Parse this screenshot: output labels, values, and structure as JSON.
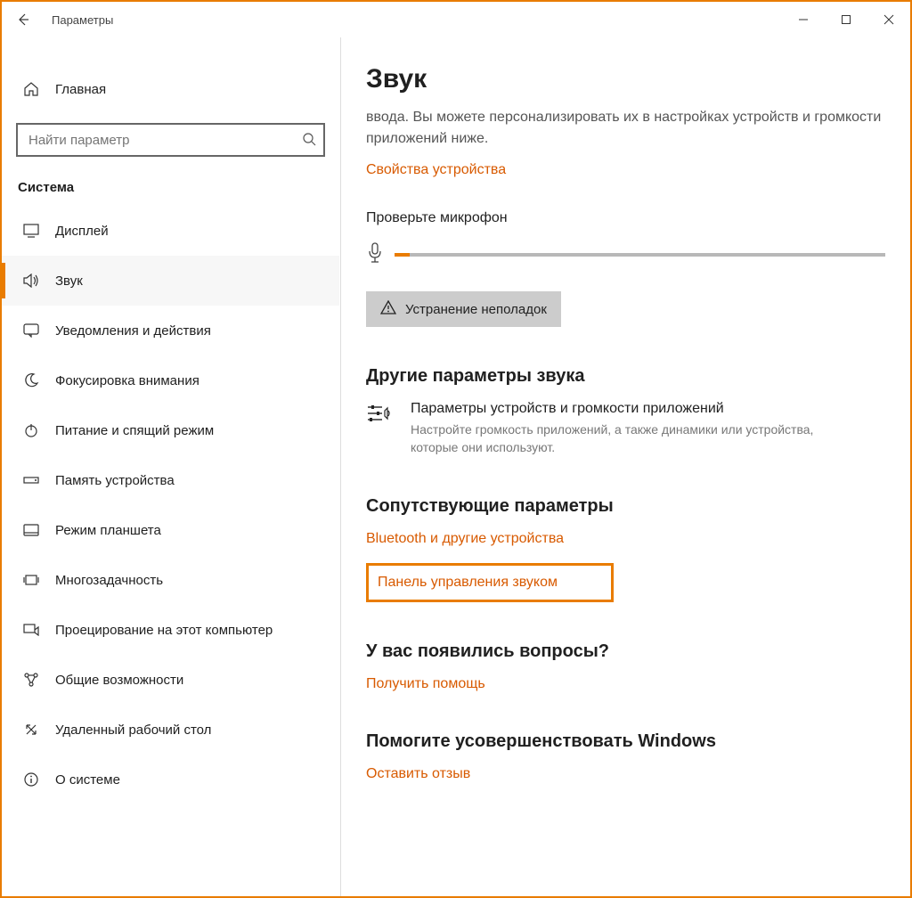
{
  "window": {
    "title": "Параметры"
  },
  "sidebar": {
    "home_label": "Главная",
    "search_placeholder": "Найти параметр",
    "section": "Система",
    "items": [
      {
        "label": "Дисплей"
      },
      {
        "label": "Звук"
      },
      {
        "label": "Уведомления и действия"
      },
      {
        "label": "Фокусировка внимания"
      },
      {
        "label": "Питание и спящий режим"
      },
      {
        "label": "Память устройства"
      },
      {
        "label": "Режим планшета"
      },
      {
        "label": "Многозадачность"
      },
      {
        "label": "Проецирование на этот компьютер"
      },
      {
        "label": "Общие возможности"
      },
      {
        "label": "Удаленный рабочий стол"
      },
      {
        "label": "О системе"
      }
    ]
  },
  "content": {
    "title": "Звук",
    "description": "ввода. Вы можете персонализировать их в настройках устройств и громкости приложений ниже.",
    "device_props_link": "Свойства устройства",
    "mic_check_label": "Проверьте микрофон",
    "troubleshoot_btn": "Устранение неполадок",
    "other_sound_title": "Другие параметры звука",
    "volume_option_title": "Параметры устройств и громкости приложений",
    "volume_option_desc": "Настройте громкость приложений, а также динамики или устройства, которые они используют.",
    "related_title": "Сопутствующие параметры",
    "related_link1": "Bluetooth и другие устройства",
    "related_link2": "Панель управления звуком",
    "questions_title": "У вас появились вопросы?",
    "help_link": "Получить помощь",
    "feedback_title": "Помогите усовершенствовать Windows",
    "feedback_link": "Оставить отзыв"
  }
}
